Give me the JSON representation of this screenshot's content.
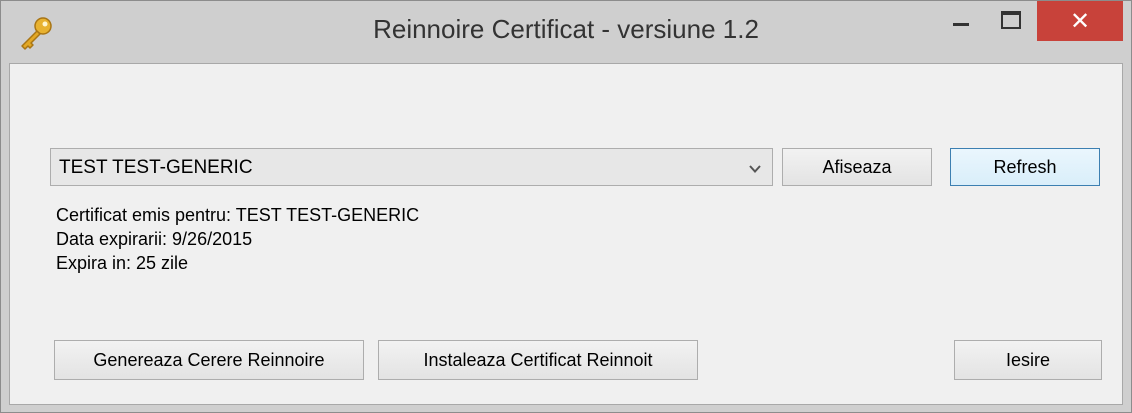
{
  "window": {
    "title": "Reinnoire Certificat - versiune 1.2",
    "app_icon": "key-icon",
    "controls": {
      "minimize": "minimize-icon",
      "maximize": "maximize-icon",
      "close": "close-icon",
      "close_glyph": "✕"
    },
    "close_color": "#c8423a"
  },
  "certificate_select": {
    "selected": "TEST TEST-GENERIC"
  },
  "buttons": {
    "afiseaza": "Afiseaza",
    "refresh": "Refresh",
    "genereaza": "Genereaza Cerere Reinnoire",
    "instaleaza": "Instaleaza Certificat Reinnoit",
    "iesire": "Iesire"
  },
  "info": {
    "emis_pentru": "Certificat emis pentru: TEST TEST-GENERIC",
    "data_expirarii": "Data expirarii: 9/26/2015",
    "expira_in": "Expira in: 25 zile"
  }
}
